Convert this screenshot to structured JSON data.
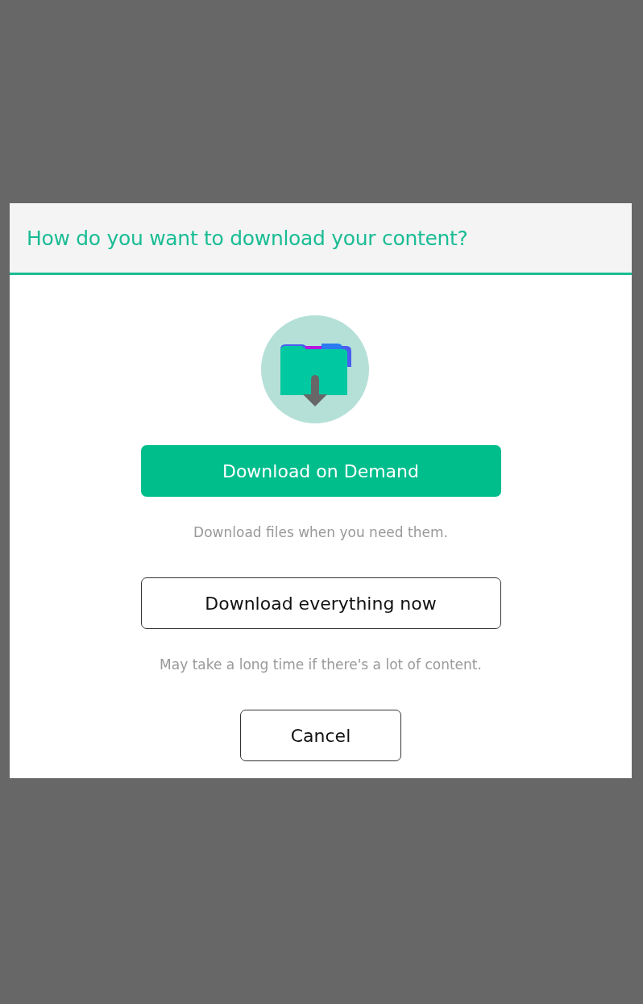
{
  "dialog": {
    "title": "How do you want to download your content?",
    "options": [
      {
        "label": "Download on Demand",
        "kind": "primary",
        "description": "Download files when you need them."
      },
      {
        "label": "Download everything now",
        "kind": "outline",
        "description": "May take a long time if there's a lot of content."
      }
    ],
    "cancel": "Cancel"
  }
}
